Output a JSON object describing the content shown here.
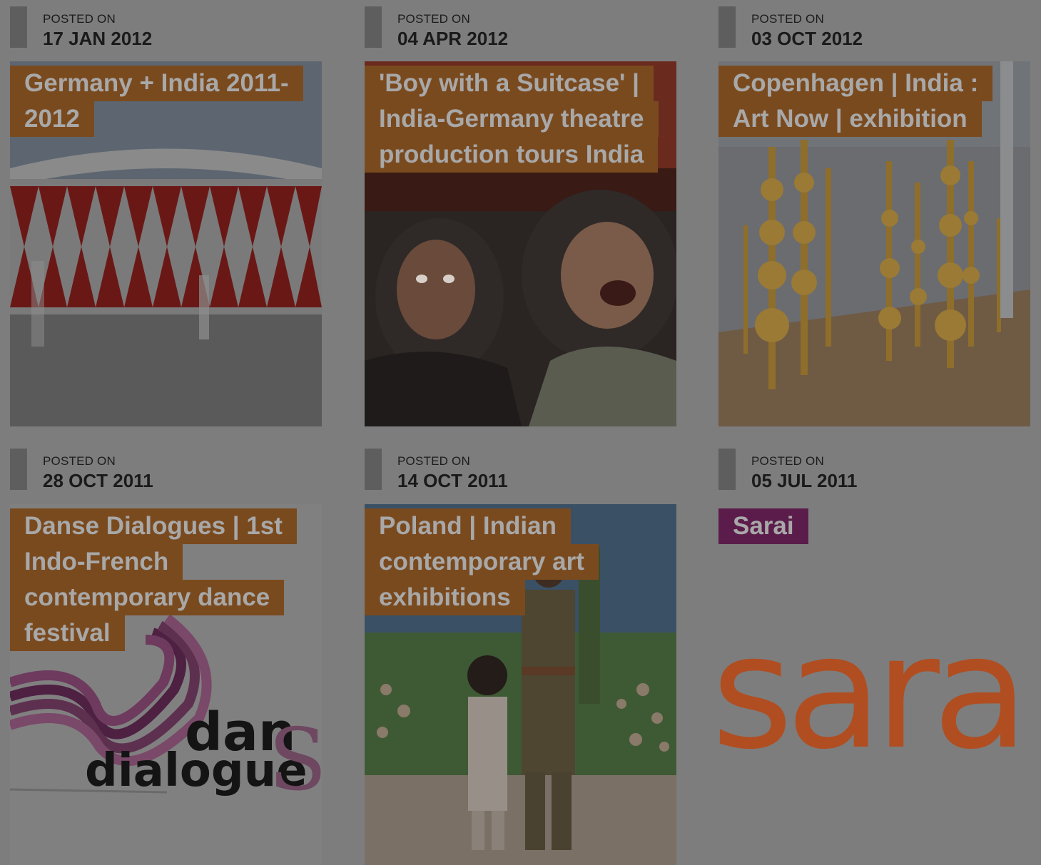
{
  "posts": [
    {
      "posted_label": "POSTED ON",
      "date": "17 JAN 2012",
      "title_lines": [
        "Germany + India 2011-",
        "2012"
      ],
      "image": "germany-india-pavilion-image"
    },
    {
      "posted_label": "POSTED ON",
      "date": "04 APR 2012",
      "title_lines": [
        "'Boy with a Suitcase' |",
        "India-Germany theatre",
        "production tours India"
      ],
      "image": "theatre-actors-photo"
    },
    {
      "posted_label": "POSTED ON",
      "date": "03 OCT 2012",
      "title_lines": [
        "Copenhagen | India :",
        "Art Now | exhibition"
      ],
      "image": "golden-sculptures-exhibition-photo"
    },
    {
      "posted_label": "POSTED ON",
      "date": "28 OCT 2011",
      "title_lines": [
        "Danse Dialogues | 1st",
        "Indo-French",
        "contemporary dance",
        "festival"
      ],
      "image": "danse-dialogues-logo",
      "logo_text": {
        "line1": "dan",
        "line2": "dialogue",
        "s_glyph": "S"
      }
    },
    {
      "posted_label": "POSTED ON",
      "date": "14 OCT 2011",
      "title_lines": [
        "Poland | Indian",
        "contemporary art",
        "exhibitions"
      ],
      "image": "policeman-and-child-photo"
    },
    {
      "posted_label": "POSTED ON",
      "date": "05 JUL 2011",
      "title_lines": [
        "Sarai"
      ],
      "image": "sarai-logo",
      "logo_text": {
        "word": "sarai"
      }
    }
  ],
  "colors": {
    "overlay_background": "#7d7d7d",
    "title_bg_brown": "#7a4a1f",
    "title_bg_purple": "#5b1c4b",
    "title_text": "#a8a8a8",
    "sarai_orange": "#b04e21"
  }
}
